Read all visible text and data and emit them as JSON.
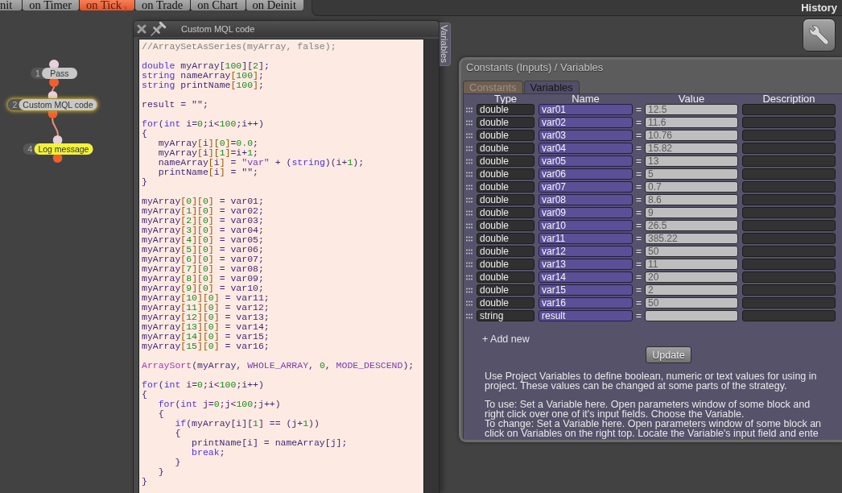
{
  "event_tabs": [
    {
      "label": "nit",
      "selected": false
    },
    {
      "label": "on Timer",
      "selected": false
    },
    {
      "label": "on Tick",
      "selected": true,
      "badge": "3"
    },
    {
      "label": "on Trade",
      "selected": false
    },
    {
      "label": "on Chart",
      "selected": false
    },
    {
      "label": "on Deinit",
      "selected": false
    }
  ],
  "history_button": "History",
  "flow_blocks": [
    {
      "number": "1",
      "label": "Pass",
      "selected": false,
      "color": "#c8c8c8"
    },
    {
      "number": "2",
      "label": "Custom MQL code",
      "selected": true,
      "color": "#c8c8c8"
    },
    {
      "number": "4",
      "label": "Log message",
      "selected": false,
      "color": "#f2f23c"
    }
  ],
  "code_window": {
    "title": "Custom MQL code",
    "side_tab": "Variables",
    "code_blocks": [
      {
        "lines": [
          [
            {
              "kind": "comment",
              "text": "//ArraySetAsSeries(myArray, false);"
            }
          ]
        ]
      },
      {
        "lines": [
          [
            {
              "kind": "keyword",
              "text": "double"
            },
            {
              "kind": "plain",
              "text": " myArray["
            },
            {
              "kind": "number",
              "text": "100"
            },
            {
              "kind": "plain",
              "text": "]["
            },
            {
              "kind": "number",
              "text": "2"
            },
            {
              "kind": "plain",
              "text": "];"
            }
          ],
          [
            {
              "kind": "keyword",
              "text": "string"
            },
            {
              "kind": "plain",
              "text": " nameArray"
            },
            {
              "kind": "bracket",
              "text": "["
            },
            {
              "kind": "number",
              "text": "100"
            },
            {
              "kind": "bracket",
              "text": "]"
            },
            {
              "kind": "plain",
              "text": ";"
            }
          ],
          [
            {
              "kind": "keyword",
              "text": "string"
            },
            {
              "kind": "plain",
              "text": " printName"
            },
            {
              "kind": "bracket",
              "text": "["
            },
            {
              "kind": "number",
              "text": "100"
            },
            {
              "kind": "bracket",
              "text": "]"
            },
            {
              "kind": "plain",
              "text": ";"
            }
          ]
        ]
      },
      {
        "lines": [
          [
            {
              "kind": "plain",
              "text": "result = \"\";"
            }
          ]
        ]
      },
      {
        "lines": [
          [
            {
              "kind": "keyword",
              "text": "for"
            },
            {
              "kind": "plain",
              "text": "("
            },
            {
              "kind": "keyword",
              "text": "int"
            },
            {
              "kind": "plain",
              "text": " i="
            },
            {
              "kind": "number",
              "text": "0"
            },
            {
              "kind": "plain",
              "text": ";i<"
            },
            {
              "kind": "number",
              "text": "100"
            },
            {
              "kind": "plain",
              "text": ";i++)"
            }
          ],
          [
            {
              "kind": "plain",
              "text": "{"
            }
          ],
          [
            {
              "kind": "plain",
              "text": "   myArray"
            },
            {
              "kind": "bracket",
              "text": "["
            },
            {
              "kind": "plain",
              "text": "i"
            },
            {
              "kind": "bracket",
              "text": "]["
            },
            {
              "kind": "number",
              "text": "0"
            },
            {
              "kind": "bracket",
              "text": "]"
            },
            {
              "kind": "plain",
              "text": "="
            },
            {
              "kind": "number",
              "text": "0.0"
            },
            {
              "kind": "plain",
              "text": ";"
            }
          ],
          [
            {
              "kind": "plain",
              "text": "   myArray"
            },
            {
              "kind": "bracket",
              "text": "["
            },
            {
              "kind": "plain",
              "text": "i"
            },
            {
              "kind": "bracket",
              "text": "]["
            },
            {
              "kind": "number",
              "text": "1"
            },
            {
              "kind": "bracket",
              "text": "]"
            },
            {
              "kind": "plain",
              "text": "=i+"
            },
            {
              "kind": "number",
              "text": "1"
            },
            {
              "kind": "plain",
              "text": ";"
            }
          ],
          [
            {
              "kind": "plain",
              "text": "   nameArray"
            },
            {
              "kind": "bracket",
              "text": "["
            },
            {
              "kind": "plain",
              "text": "i"
            },
            {
              "kind": "bracket",
              "text": "]"
            },
            {
              "kind": "plain",
              "text": " = "
            },
            {
              "kind": "string",
              "text": "\"var\""
            },
            {
              "kind": "plain",
              "text": " + ("
            },
            {
              "kind": "keyword",
              "text": "string"
            },
            {
              "kind": "plain",
              "text": ")(i+"
            },
            {
              "kind": "number",
              "text": "1"
            },
            {
              "kind": "plain",
              "text": ");"
            }
          ],
          [
            {
              "kind": "plain",
              "text": "   printName"
            },
            {
              "kind": "bracket",
              "text": "["
            },
            {
              "kind": "plain",
              "text": "i"
            },
            {
              "kind": "bracket",
              "text": "]"
            },
            {
              "kind": "plain",
              "text": " = \"\";"
            }
          ],
          [
            {
              "kind": "plain",
              "text": "}"
            }
          ]
        ]
      },
      {
        "lines": [
          [
            {
              "kind": "plain",
              "text": "myArray"
            },
            {
              "kind": "bracket",
              "text": "["
            },
            {
              "kind": "number",
              "text": "0"
            },
            {
              "kind": "bracket",
              "text": "]["
            },
            {
              "kind": "number",
              "text": "0"
            },
            {
              "kind": "bracket",
              "text": "]"
            },
            {
              "kind": "plain",
              "text": " = var01;"
            }
          ],
          [
            {
              "kind": "plain",
              "text": "myArray"
            },
            {
              "kind": "bracket",
              "text": "["
            },
            {
              "kind": "number",
              "text": "1"
            },
            {
              "kind": "bracket",
              "text": "]["
            },
            {
              "kind": "number",
              "text": "0"
            },
            {
              "kind": "bracket",
              "text": "]"
            },
            {
              "kind": "plain",
              "text": " = var02;"
            }
          ],
          [
            {
              "kind": "plain",
              "text": "myArray"
            },
            {
              "kind": "bracket",
              "text": "["
            },
            {
              "kind": "number",
              "text": "2"
            },
            {
              "kind": "bracket",
              "text": "]["
            },
            {
              "kind": "number",
              "text": "0"
            },
            {
              "kind": "bracket",
              "text": "]"
            },
            {
              "kind": "plain",
              "text": " = var03;"
            }
          ],
          [
            {
              "kind": "plain",
              "text": "myArray"
            },
            {
              "kind": "bracket",
              "text": "["
            },
            {
              "kind": "number",
              "text": "3"
            },
            {
              "kind": "bracket",
              "text": "]["
            },
            {
              "kind": "number",
              "text": "0"
            },
            {
              "kind": "bracket",
              "text": "]"
            },
            {
              "kind": "plain",
              "text": " = var04;"
            }
          ],
          [
            {
              "kind": "plain",
              "text": "myArray"
            },
            {
              "kind": "bracket",
              "text": "["
            },
            {
              "kind": "number",
              "text": "4"
            },
            {
              "kind": "bracket",
              "text": "]["
            },
            {
              "kind": "number",
              "text": "0"
            },
            {
              "kind": "bracket",
              "text": "]"
            },
            {
              "kind": "plain",
              "text": " = var05;"
            }
          ],
          [
            {
              "kind": "plain",
              "text": "myArray"
            },
            {
              "kind": "bracket",
              "text": "["
            },
            {
              "kind": "number",
              "text": "5"
            },
            {
              "kind": "bracket",
              "text": "]["
            },
            {
              "kind": "number",
              "text": "0"
            },
            {
              "kind": "bracket",
              "text": "]"
            },
            {
              "kind": "plain",
              "text": " = var06;"
            }
          ],
          [
            {
              "kind": "plain",
              "text": "myArray"
            },
            {
              "kind": "bracket",
              "text": "["
            },
            {
              "kind": "number",
              "text": "6"
            },
            {
              "kind": "bracket",
              "text": "]["
            },
            {
              "kind": "number",
              "text": "0"
            },
            {
              "kind": "bracket",
              "text": "]"
            },
            {
              "kind": "plain",
              "text": " = var07;"
            }
          ],
          [
            {
              "kind": "plain",
              "text": "myArray"
            },
            {
              "kind": "bracket",
              "text": "["
            },
            {
              "kind": "number",
              "text": "7"
            },
            {
              "kind": "bracket",
              "text": "]["
            },
            {
              "kind": "number",
              "text": "0"
            },
            {
              "kind": "bracket",
              "text": "]"
            },
            {
              "kind": "plain",
              "text": " = var08;"
            }
          ],
          [
            {
              "kind": "plain",
              "text": "myArray"
            },
            {
              "kind": "bracket",
              "text": "["
            },
            {
              "kind": "number",
              "text": "8"
            },
            {
              "kind": "bracket",
              "text": "]["
            },
            {
              "kind": "number",
              "text": "0"
            },
            {
              "kind": "bracket",
              "text": "]"
            },
            {
              "kind": "plain",
              "text": " = var09;"
            }
          ],
          [
            {
              "kind": "plain",
              "text": "myArray"
            },
            {
              "kind": "bracket",
              "text": "["
            },
            {
              "kind": "number",
              "text": "9"
            },
            {
              "kind": "bracket",
              "text": "]["
            },
            {
              "kind": "number",
              "text": "0"
            },
            {
              "kind": "bracket",
              "text": "]"
            },
            {
              "kind": "plain",
              "text": " = var10;"
            }
          ],
          [
            {
              "kind": "plain",
              "text": "myArray"
            },
            {
              "kind": "bracket",
              "text": "["
            },
            {
              "kind": "number",
              "text": "10"
            },
            {
              "kind": "bracket",
              "text": "]["
            },
            {
              "kind": "number",
              "text": "0"
            },
            {
              "kind": "bracket",
              "text": "]"
            },
            {
              "kind": "plain",
              "text": " = var11;"
            }
          ],
          [
            {
              "kind": "plain",
              "text": "myArray"
            },
            {
              "kind": "bracket",
              "text": "["
            },
            {
              "kind": "number",
              "text": "11"
            },
            {
              "kind": "bracket",
              "text": "]["
            },
            {
              "kind": "number",
              "text": "0"
            },
            {
              "kind": "bracket",
              "text": "]"
            },
            {
              "kind": "plain",
              "text": " = var12;"
            }
          ],
          [
            {
              "kind": "plain",
              "text": "myArray"
            },
            {
              "kind": "bracket",
              "text": "["
            },
            {
              "kind": "number",
              "text": "12"
            },
            {
              "kind": "bracket",
              "text": "]["
            },
            {
              "kind": "number",
              "text": "0"
            },
            {
              "kind": "bracket",
              "text": "]"
            },
            {
              "kind": "plain",
              "text": " = var13;"
            }
          ],
          [
            {
              "kind": "plain",
              "text": "myArray"
            },
            {
              "kind": "bracket",
              "text": "["
            },
            {
              "kind": "number",
              "text": "13"
            },
            {
              "kind": "bracket",
              "text": "]["
            },
            {
              "kind": "number",
              "text": "0"
            },
            {
              "kind": "bracket",
              "text": "]"
            },
            {
              "kind": "plain",
              "text": " = var14;"
            }
          ],
          [
            {
              "kind": "plain",
              "text": "myArray"
            },
            {
              "kind": "bracket",
              "text": "["
            },
            {
              "kind": "number",
              "text": "14"
            },
            {
              "kind": "bracket",
              "text": "]["
            },
            {
              "kind": "number",
              "text": "0"
            },
            {
              "kind": "bracket",
              "text": "]"
            },
            {
              "kind": "plain",
              "text": " = var15;"
            }
          ],
          [
            {
              "kind": "plain",
              "text": "myArray"
            },
            {
              "kind": "bracket",
              "text": "["
            },
            {
              "kind": "number",
              "text": "15"
            },
            {
              "kind": "bracket",
              "text": "]["
            },
            {
              "kind": "number",
              "text": "0"
            },
            {
              "kind": "bracket",
              "text": "]"
            },
            {
              "kind": "plain",
              "text": " = var16;"
            }
          ]
        ]
      },
      {
        "lines": [
          [
            {
              "kind": "function",
              "text": "ArraySort"
            },
            {
              "kind": "plain",
              "text": "(myArray, "
            },
            {
              "kind": "constant",
              "text": "WHOLE_ARRAY"
            },
            {
              "kind": "plain",
              "text": ", "
            },
            {
              "kind": "number",
              "text": "0"
            },
            {
              "kind": "plain",
              "text": ", "
            },
            {
              "kind": "constant",
              "text": "MODE_DESCEND"
            },
            {
              "kind": "plain",
              "text": ");"
            }
          ]
        ]
      },
      {
        "lines": [
          [
            {
              "kind": "keyword",
              "text": "for"
            },
            {
              "kind": "plain",
              "text": "("
            },
            {
              "kind": "keyword",
              "text": "int"
            },
            {
              "kind": "plain",
              "text": " i="
            },
            {
              "kind": "number",
              "text": "0"
            },
            {
              "kind": "plain",
              "text": ";i<"
            },
            {
              "kind": "number",
              "text": "100"
            },
            {
              "kind": "plain",
              "text": ";i++)"
            }
          ],
          [
            {
              "kind": "plain",
              "text": "{"
            }
          ],
          [
            {
              "kind": "keyword",
              "text": "   for"
            },
            {
              "kind": "plain",
              "text": "("
            },
            {
              "kind": "keyword",
              "text": "int"
            },
            {
              "kind": "plain",
              "text": " j="
            },
            {
              "kind": "number",
              "text": "0"
            },
            {
              "kind": "plain",
              "text": ";j<"
            },
            {
              "kind": "number",
              "text": "100"
            },
            {
              "kind": "plain",
              "text": ";j++)"
            }
          ],
          [
            {
              "kind": "plain",
              "text": "   {"
            }
          ],
          [
            {
              "kind": "keyword",
              "text": "      if"
            },
            {
              "kind": "plain",
              "text": "(myArray[i]["
            },
            {
              "kind": "number",
              "text": "1"
            },
            {
              "kind": "plain",
              "text": "] == (j+"
            },
            {
              "kind": "number",
              "text": "1"
            },
            {
              "kind": "plain",
              "text": "))"
            }
          ],
          [
            {
              "kind": "plain",
              "text": "      {"
            }
          ],
          [
            {
              "kind": "plain",
              "text": "         printName[i] = nameArray[j];"
            }
          ],
          [
            {
              "kind": "keyword",
              "text": "         break"
            },
            {
              "kind": "plain",
              "text": ";"
            }
          ],
          [
            {
              "kind": "plain",
              "text": "      }"
            }
          ],
          [
            {
              "kind": "plain",
              "text": "   }"
            }
          ],
          [
            {
              "kind": "plain",
              "text": "}"
            }
          ]
        ]
      }
    ]
  },
  "variables_panel": {
    "title": "Constants (Inputs) / Variables",
    "tabs": [
      {
        "label": "Constants",
        "selected": false
      },
      {
        "label": "Variables",
        "selected": true
      }
    ],
    "columns": [
      "Type",
      "Name",
      "Value",
      "Description"
    ],
    "rows": [
      {
        "type": "double",
        "name": "var01",
        "sign": "=",
        "value": "12.5"
      },
      {
        "type": "double",
        "name": "var02",
        "sign": "=",
        "value": "11.6"
      },
      {
        "type": "double",
        "name": "var03",
        "sign": "=",
        "value": "10.76"
      },
      {
        "type": "double",
        "name": "var04",
        "sign": "=",
        "value": "15.82"
      },
      {
        "type": "double",
        "name": "var05",
        "sign": "=",
        "value": "13"
      },
      {
        "type": "double",
        "name": "var06",
        "sign": "=",
        "value": "5"
      },
      {
        "type": "double",
        "name": "var07",
        "sign": "=",
        "value": "0.7"
      },
      {
        "type": "double",
        "name": "var08",
        "sign": "=",
        "value": "8.6"
      },
      {
        "type": "double",
        "name": "var09",
        "sign": "=",
        "value": "9"
      },
      {
        "type": "double",
        "name": "var10",
        "sign": "=",
        "value": "26.5"
      },
      {
        "type": "double",
        "name": "var11",
        "sign": "=",
        "value": "385.22"
      },
      {
        "type": "double",
        "name": "var12",
        "sign": "=",
        "value": "50"
      },
      {
        "type": "double",
        "name": "var13",
        "sign": "=",
        "value": "11"
      },
      {
        "type": "double",
        "name": "var14",
        "sign": "=",
        "value": "20"
      },
      {
        "type": "double",
        "name": "var15",
        "sign": "=",
        "value": "2"
      },
      {
        "type": "double",
        "name": "var16",
        "sign": "=",
        "value": "50"
      },
      {
        "type": "string",
        "name": "result",
        "sign": "="
      }
    ],
    "add_new": "+ Add new",
    "update_button": "Update",
    "help": [
      {
        "lines": [
          "Use Project Variables to define boolean, numeric or text values for using in",
          "project. These values can be changed at some parts of the strategy."
        ]
      },
      {
        "lines": [
          "To use: Set a Variable here. Open parameters window of some block and",
          "right click over one of it's input fields. Choose the Variable.",
          "To change: Set a Variable here. Open parameters window of some block an",
          "click on Variables on the right top. Locate the Variable's input field and ente"
        ]
      }
    ]
  }
}
